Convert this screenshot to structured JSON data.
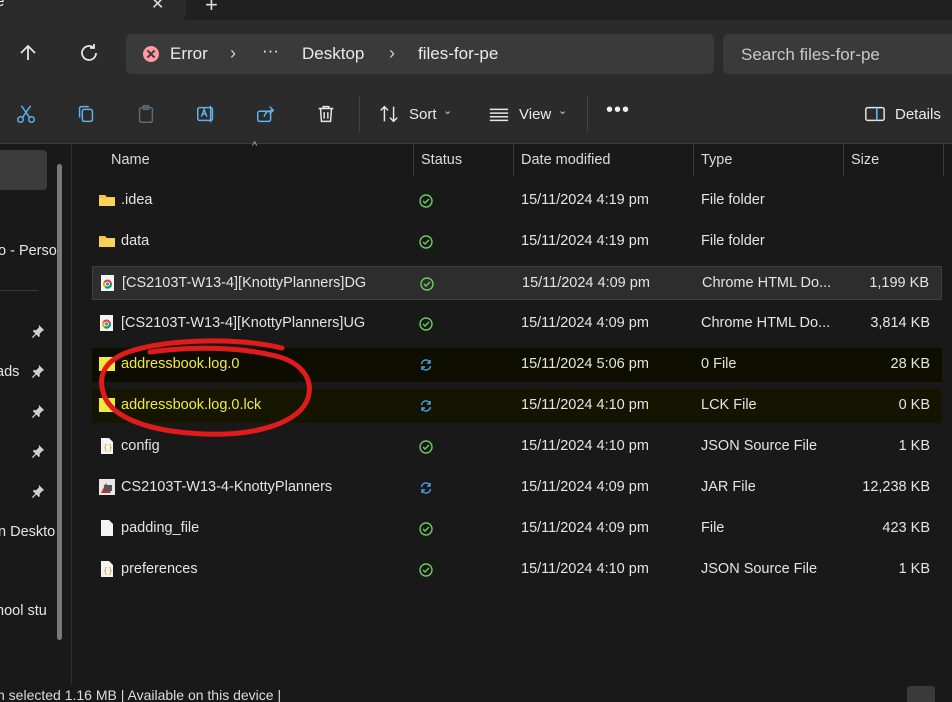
{
  "tab": {
    "title": "e",
    "close": "✕",
    "new": "+"
  },
  "address": {
    "error_label": "Error",
    "ellipsis": "···",
    "crumbs": [
      "Desktop",
      "files-for-pe"
    ],
    "search_placeholder": "Search files-for-pe"
  },
  "toolbar": {
    "sort_label": "Sort",
    "view_label": "View",
    "more": "•••",
    "details_label": "Details"
  },
  "nav": {
    "items": [
      {
        "label": "o - Perso"
      },
      {
        "label": "ads"
      },
      {
        "label": "n Deskto"
      },
      {
        "label": "hool stu"
      }
    ]
  },
  "columns": {
    "name": "Name",
    "status": "Status",
    "date": "Date modified",
    "type": "Type",
    "size": "Size"
  },
  "files": [
    {
      "name": ".idea",
      "icon": "folder-icon",
      "status": "synced",
      "date": "15/11/2024 4:19 pm",
      "type": "File folder",
      "size": ""
    },
    {
      "name": "data",
      "icon": "folder-icon",
      "status": "synced",
      "date": "15/11/2024 4:19 pm",
      "type": "File folder",
      "size": ""
    },
    {
      "name": "[CS2103T-W13-4][KnottyPlanners]DG",
      "icon": "chrome-html-icon",
      "status": "synced",
      "date": "15/11/2024 4:09 pm",
      "type": "Chrome HTML Do...",
      "size": "1,199 KB"
    },
    {
      "name": "[CS2103T-W13-4][KnottyPlanners]UG",
      "icon": "chrome-html-icon",
      "status": "synced",
      "date": "15/11/2024 4:09 pm",
      "type": "Chrome HTML Do...",
      "size": "3,814 KB"
    },
    {
      "name": "addressbook.log.0",
      "icon": "file-icon",
      "status": "syncing",
      "date": "15/11/2024 5:06 pm",
      "type": "0 File",
      "size": "28 KB"
    },
    {
      "name": "addressbook.log.0.lck",
      "icon": "file-icon",
      "status": "syncing",
      "date": "15/11/2024 4:10 pm",
      "type": "LCK File",
      "size": "0 KB"
    },
    {
      "name": "config",
      "icon": "json-file-icon",
      "status": "synced",
      "date": "15/11/2024 4:10 pm",
      "type": "JSON Source File",
      "size": "1 KB"
    },
    {
      "name": "CS2103T-W13-4-KnottyPlanners",
      "icon": "jar-file-icon",
      "status": "syncing",
      "date": "15/11/2024 4:09 pm",
      "type": "JAR File",
      "size": "12,238 KB"
    },
    {
      "name": "padding_file",
      "icon": "file-icon",
      "status": "synced",
      "date": "15/11/2024 4:09 pm",
      "type": "File",
      "size": "423 KB"
    },
    {
      "name": "preferences",
      "icon": "json-file-icon",
      "status": "synced",
      "date": "15/11/2024 4:10 pm",
      "type": "JSON Source File",
      "size": "1 KB"
    }
  ],
  "statusbar": {
    "text": "n selected  1.16 MB  |  Available on this device  |"
  },
  "colors": {
    "window_bg": "#191919",
    "chrome_bg": "#2b2b2b",
    "accent_blue": "#4aa3e8",
    "synced_green": "#6ccb5f",
    "highlight_yellow": "#f2ea3a",
    "annotation_red": "#e01b1b"
  }
}
